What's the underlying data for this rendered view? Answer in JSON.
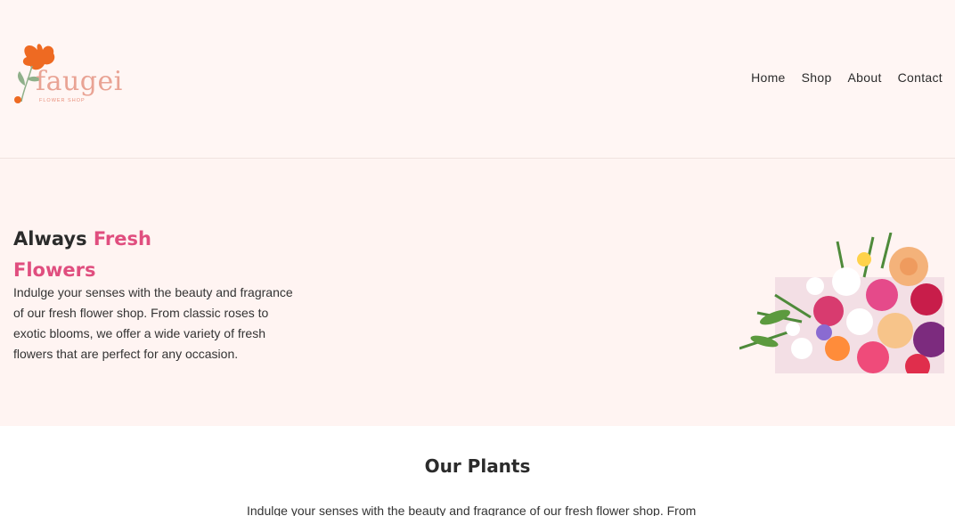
{
  "brand": {
    "name": "faugei",
    "tagline": "FLOWER SHOP",
    "accent": "#e04e7f",
    "logo_orange": "#ee6a22"
  },
  "nav": {
    "items": [
      {
        "label": "Home"
      },
      {
        "label": "Shop"
      },
      {
        "label": "About"
      },
      {
        "label": "Contact"
      }
    ]
  },
  "hero": {
    "title_plain": "Always",
    "title_accent_1": "Fresh",
    "title_accent_2": "Flowers",
    "text": "Indulge your senses with the beauty and fragrance of our fresh flower shop. From classic roses to exotic blooms, we offer a wide variety of fresh flowers that are perfect for any occasion."
  },
  "plants": {
    "title": "Our Plants",
    "text": "Indulge your senses with the beauty and fragrance of our fresh flower shop. From"
  }
}
